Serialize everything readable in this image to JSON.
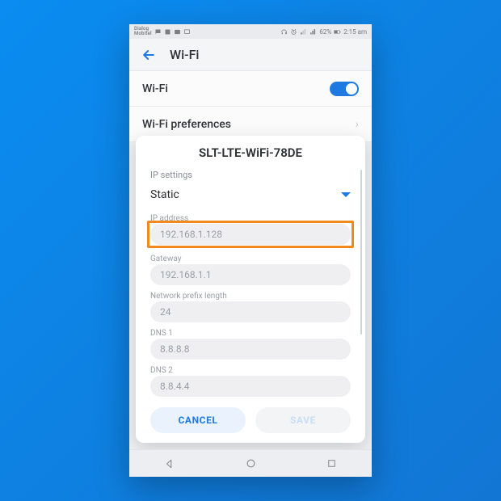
{
  "statusbar": {
    "carrier": "Dialog\nMobitel",
    "battery_pct": "62%",
    "time": "2:15 am"
  },
  "header": {
    "title": "Wi-Fi"
  },
  "rows": {
    "wifi_label": "Wi-Fi",
    "prefs_label": "Wi-Fi preferences"
  },
  "dialog": {
    "title": "SLT-LTE-WiFi-78DE",
    "ip_settings_label": "IP settings",
    "ip_settings_value": "Static",
    "fields": {
      "ip_address": {
        "label": "IP address",
        "value": "192.168.1.128"
      },
      "gateway": {
        "label": "Gateway",
        "value": "192.168.1.1"
      },
      "prefix": {
        "label": "Network prefix length",
        "value": "24"
      },
      "dns1": {
        "label": "DNS 1",
        "value": "8.8.8.8"
      },
      "dns2": {
        "label": "DNS 2",
        "value": "8.8.4.4"
      }
    },
    "cancel": "CANCEL",
    "save": "SAVE"
  },
  "annotation": {
    "highlight_field": "ip_address",
    "highlight_color": "#f08a1d"
  },
  "colors": {
    "accent": "#1e7ae0",
    "bg_gradient_from": "#0a8cf0",
    "bg_gradient_to": "#1276d4"
  }
}
